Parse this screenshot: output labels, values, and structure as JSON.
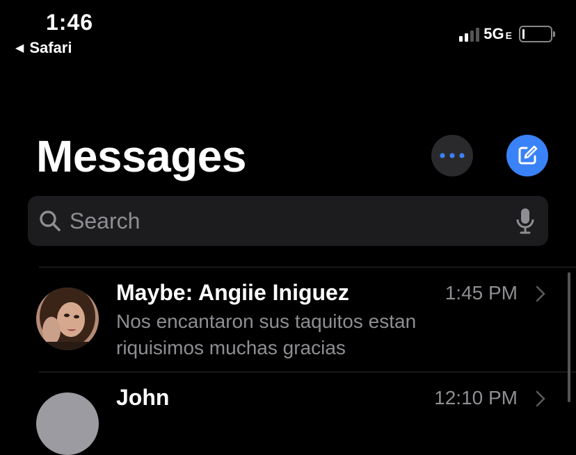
{
  "status_bar": {
    "time": "1:46",
    "back_app": "Safari",
    "network": "5G",
    "network_suffix": "E"
  },
  "header": {
    "title": "Messages",
    "more_icon": "ellipsis-icon",
    "compose_icon": "compose-icon",
    "accent_color": "#3a82f7"
  },
  "search": {
    "placeholder": "Search"
  },
  "conversations": [
    {
      "name": "Maybe: Angiie Iniguez",
      "time": "1:45 PM",
      "preview": "Nos encantaron sus taquitos estan riquisimos muchas gracias"
    },
    {
      "name": "John",
      "time": "12:10 PM",
      "preview": ""
    }
  ]
}
